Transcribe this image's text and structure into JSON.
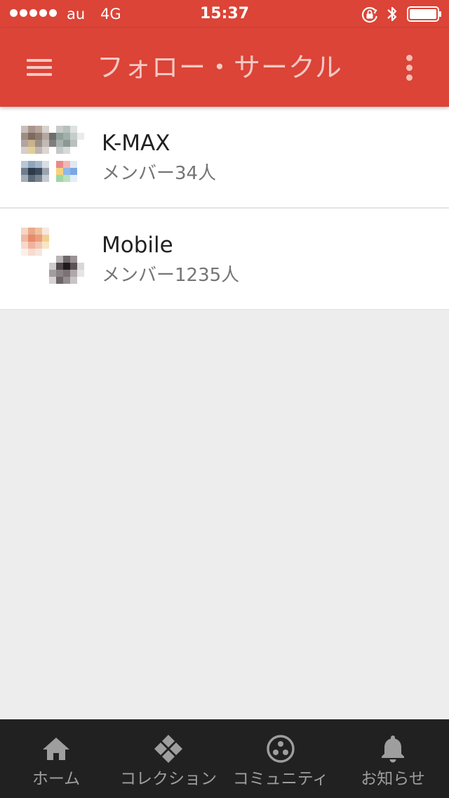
{
  "status_bar": {
    "carrier": "au",
    "network": "4G",
    "time": "15:37",
    "icons": [
      "signal-dots-icon",
      "rotation-lock-icon",
      "bluetooth-icon",
      "battery-icon"
    ]
  },
  "app_bar": {
    "title": "フォロー・サークル",
    "menu_icon": "hamburger-menu-icon",
    "overflow_icon": "more-vertical-icon"
  },
  "circles": [
    {
      "name": "K-MAX",
      "members": "メンバー34人"
    },
    {
      "name": "Mobile",
      "members": "メンバー1235人"
    }
  ],
  "bottom_nav": {
    "items": [
      {
        "label": "ホーム",
        "icon": "home-icon"
      },
      {
        "label": "コレクション",
        "icon": "collections-icon"
      },
      {
        "label": "コミュニティ",
        "icon": "communities-icon"
      },
      {
        "label": "お知らせ",
        "icon": "notifications-bell-icon"
      }
    ]
  },
  "colors": {
    "primary": "#db4437",
    "title_text": "#f4c8c3",
    "background": "#ededed",
    "bottom_nav": "#212121",
    "nav_text": "#9e9e9e"
  }
}
